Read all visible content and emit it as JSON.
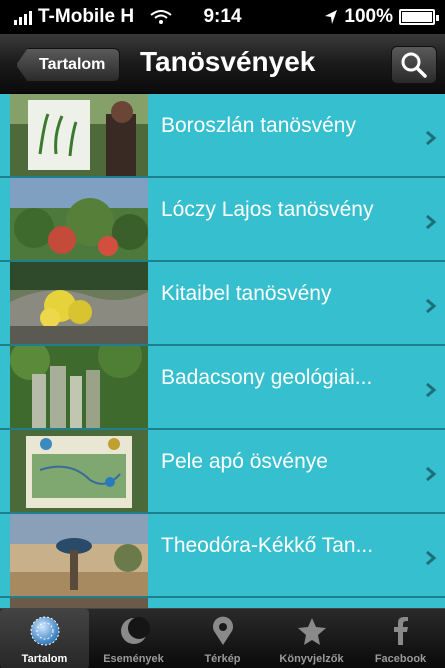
{
  "status": {
    "carrier": "T-Mobile H",
    "time": "9:14",
    "battery": "100%"
  },
  "nav": {
    "back_label": "Tartalom",
    "title": "Tanösvények"
  },
  "list": {
    "items": [
      {
        "label": "Boroszlán tanösvény"
      },
      {
        "label": "Lóczy Lajos tanösvény"
      },
      {
        "label": "Kitaibel tanösvény"
      },
      {
        "label": "Badacsony geológiai..."
      },
      {
        "label": "Pele apó ösvénye"
      },
      {
        "label": "Theodóra-Kékkő Tan..."
      }
    ]
  },
  "tabs": [
    {
      "label": "Tartalom",
      "icon": "sphere-icon",
      "selected": true
    },
    {
      "label": "Események",
      "icon": "moon-icon",
      "selected": false
    },
    {
      "label": "Térkép",
      "icon": "map-pin-icon",
      "selected": false
    },
    {
      "label": "Könyvjelzők",
      "icon": "star-icon",
      "selected": false
    },
    {
      "label": "Facebook",
      "icon": "facebook-icon",
      "selected": false
    }
  ],
  "colors": {
    "list_bg": "#36bfcf",
    "row_divider": "#1e7f8e"
  }
}
